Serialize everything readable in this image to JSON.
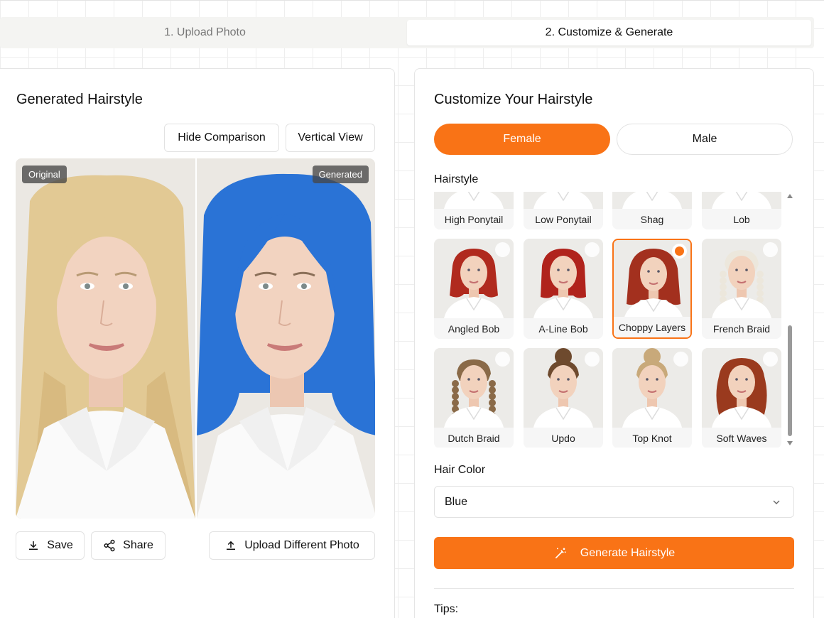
{
  "tabs": [
    {
      "label": "1. Upload Photo",
      "active": false
    },
    {
      "label": "2. Customize & Generate",
      "active": true
    }
  ],
  "left": {
    "title": "Generated Hairstyle",
    "hide_comparison": "Hide Comparison",
    "vertical_view": "Vertical View",
    "original_tag": "Original",
    "generated_tag": "Generated",
    "save": "Save",
    "share": "Share",
    "upload_different": "Upload Different Photo"
  },
  "right": {
    "title": "Customize Your Hairstyle",
    "female": "Female",
    "male": "Male",
    "hairstyle_label": "Hairstyle",
    "hairstyles": [
      {
        "label": "High Ponytail",
        "hair": "#6b3d22",
        "style": "ponytail"
      },
      {
        "label": "Low Ponytail",
        "hair": "#6b3d22",
        "style": "ponytail"
      },
      {
        "label": "Shag",
        "hair": "#6b3d22",
        "style": "short"
      },
      {
        "label": "Lob",
        "hair": "#6b3d22",
        "style": "short"
      },
      {
        "label": "Angled Bob",
        "hair": "#b02a1e",
        "style": "bob",
        "selected": false
      },
      {
        "label": "A-Line Bob",
        "hair": "#b0231c",
        "style": "bangbob",
        "selected": false
      },
      {
        "label": "Choppy Layers",
        "hair": "#a3301e",
        "style": "layers",
        "selected": true
      },
      {
        "label": "French Braid",
        "hair": "#ece7dc",
        "style": "braids",
        "selected": false
      },
      {
        "label": "Dutch Braid",
        "hair": "#8a6a48",
        "style": "braids",
        "selected": false
      },
      {
        "label": "Updo",
        "hair": "#6e4a2e",
        "style": "bun",
        "selected": false
      },
      {
        "label": "Top Knot",
        "hair": "#c8a97a",
        "style": "bun",
        "selected": false
      },
      {
        "label": "Soft Waves",
        "hair": "#9a3a1e",
        "style": "waves",
        "selected": false
      }
    ],
    "hair_color_label": "Hair Color",
    "hair_color_value": "Blue",
    "generate": "Generate Hairstyle",
    "tips_label": "Tips:"
  },
  "colors": {
    "accent": "#f97316",
    "original_hair": "#e2c994",
    "generated_hair": "#2a73d6"
  },
  "icons": {
    "save": "download-icon",
    "share": "share-icon",
    "upload": "upload-icon",
    "generate": "magic-wand-icon",
    "select": "chevron-down-icon"
  }
}
